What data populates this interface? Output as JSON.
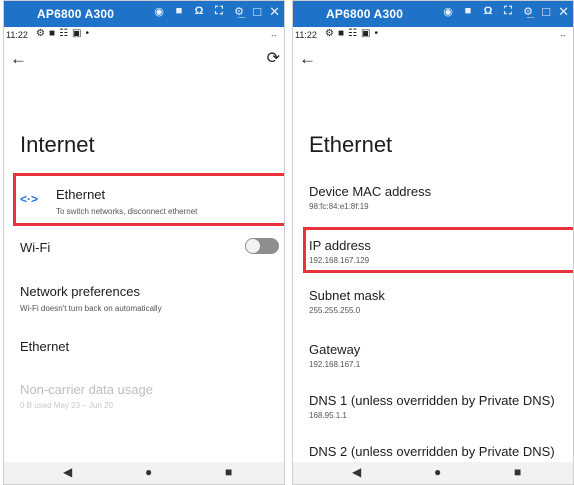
{
  "window": {
    "title": "AP6800 A300"
  },
  "status": {
    "time": "11:22"
  },
  "icons": {
    "toolbar": [
      "camera-icon",
      "video-icon",
      "headset-icon",
      "fullscreen-icon",
      "settings-icon"
    ],
    "window_controls": [
      "minimize-icon",
      "maximize-icon",
      "close-icon"
    ]
  },
  "left": {
    "title": "Internet",
    "items": [
      {
        "title": "Ethernet",
        "subtitle": "To switch networks, disconnect ethernet"
      },
      {
        "title": "Wi-Fi"
      },
      {
        "title": "Network preferences",
        "subtitle": "Wi-Fi doesn't turn back on automatically"
      },
      {
        "title": "Ethernet"
      },
      {
        "title": "Non-carrier data usage",
        "subtitle": "0 B used May 23 – Jun 20"
      }
    ],
    "wifi_enabled": false
  },
  "right": {
    "title": "Ethernet",
    "items": [
      {
        "title": "Device MAC address",
        "value": "98:fc:84:e1:8f:19"
      },
      {
        "title": "IP address",
        "value": "192.168.167.129"
      },
      {
        "title": "Subnet mask",
        "value": "255.255.255.0"
      },
      {
        "title": "Gateway",
        "value": "192.168.167.1"
      },
      {
        "title": "DNS 1 (unless overridden by Private DNS)",
        "value": "168.95.1.1"
      },
      {
        "title": "DNS 2 (unless overridden by Private DNS)",
        "value": ""
      }
    ]
  },
  "highlight_color": "#e8323c",
  "accent_color": "#1a73e8"
}
